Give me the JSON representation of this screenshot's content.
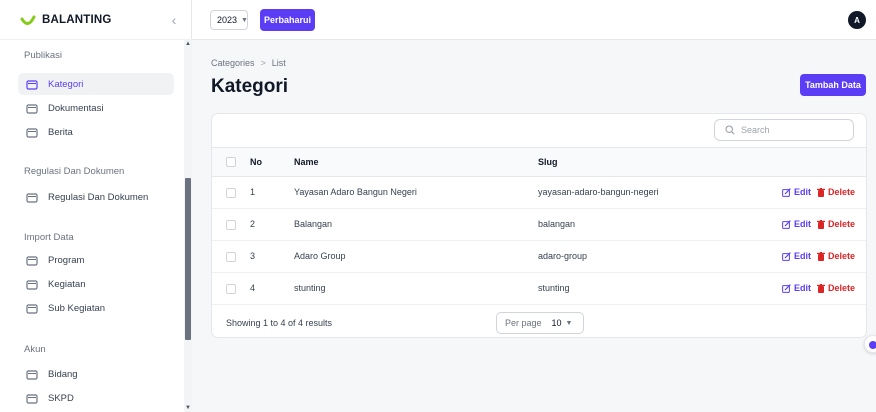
{
  "app": {
    "name": "BALANTING"
  },
  "topbar": {
    "year": "2023",
    "refresh_label": "Perbaharui",
    "avatar_initial": "A"
  },
  "sidebar": {
    "groups": [
      {
        "label": "Publikasi",
        "items": [
          {
            "label": "Kategori",
            "active": true
          },
          {
            "label": "Dokumentasi"
          },
          {
            "label": "Berita"
          }
        ]
      },
      {
        "label": "Regulasi Dan Dokumen",
        "items": [
          {
            "label": "Regulasi Dan Dokumen"
          }
        ]
      },
      {
        "label": "Import Data",
        "items": [
          {
            "label": "Program"
          },
          {
            "label": "Kegiatan"
          },
          {
            "label": "Sub Kegiatan"
          }
        ]
      },
      {
        "label": "Akun",
        "items": [
          {
            "label": "Bidang"
          },
          {
            "label": "SKPD"
          }
        ]
      }
    ]
  },
  "breadcrumb": {
    "parent": "Categories",
    "separator": ">",
    "current": "List"
  },
  "page": {
    "title": "Kategori",
    "add_label": "Tambah Data"
  },
  "table": {
    "search_placeholder": "Search",
    "columns": {
      "no": "No",
      "name": "Name",
      "slug": "Slug"
    },
    "rows": [
      {
        "no": "1",
        "name": "Yayasan Adaro Bangun Negeri",
        "slug": "yayasan-adaro-bangun-negeri"
      },
      {
        "no": "2",
        "name": "Balangan",
        "slug": "balangan"
      },
      {
        "no": "3",
        "name": "Adaro Group",
        "slug": "adaro-group"
      },
      {
        "no": "4",
        "name": "stunting",
        "slug": "stunting"
      }
    ],
    "edit_label": "Edit",
    "delete_label": "Delete",
    "summary": "Showing 1 to 4 of 4 results",
    "per_page_label": "Per page",
    "per_page_value": "10"
  },
  "colors": {
    "accent": "#5b3df5",
    "danger": "#dc2626"
  }
}
